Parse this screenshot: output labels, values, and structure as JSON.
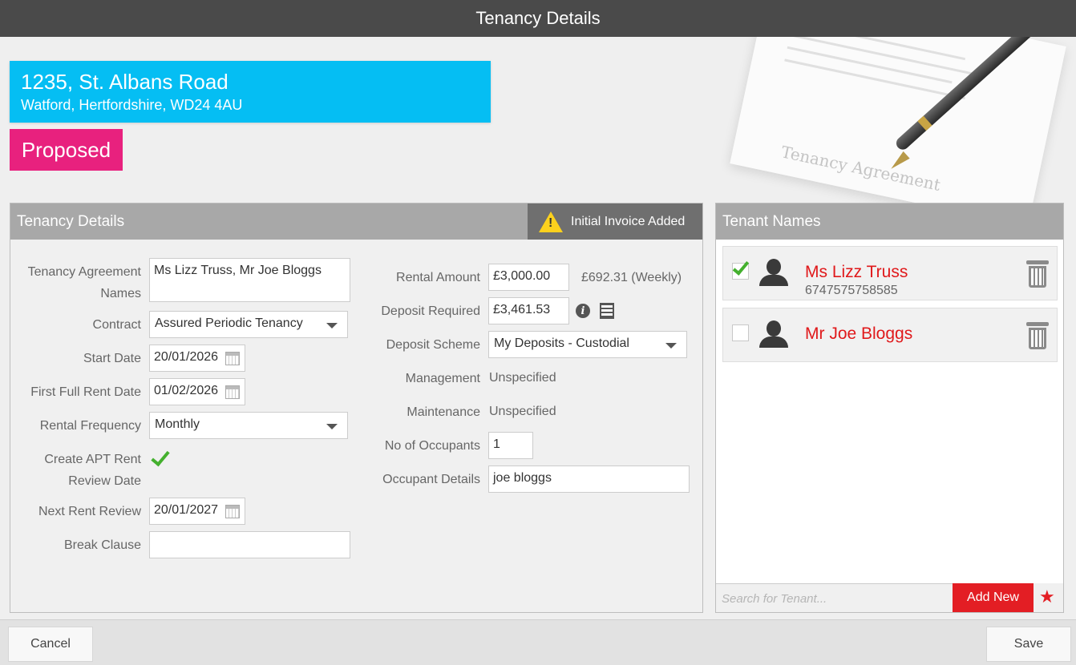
{
  "window": {
    "title": "Tenancy Details"
  },
  "hero": {
    "paper_title": "Tenancy Agreement"
  },
  "property": {
    "address_line1": "1235, St. Albans Road",
    "address_line2": "Watford, Hertfordshire, WD24 4AU",
    "status": "Proposed",
    "status_color": "#e8217e",
    "accent_color": "#05bef3"
  },
  "tenancy": {
    "panel_title": "Tenancy Details",
    "invoice_notice": "Initial Invoice Added",
    "agreement_names_label_1": "Tenancy Agreement",
    "agreement_names_label_2": "Names",
    "agreement_names_value": "Ms Lizz Truss, Mr Joe Bloggs",
    "contract_label": "Contract",
    "contract_value": "Assured Periodic Tenancy",
    "start_date_label": "Start Date",
    "start_date_value": "20/01/2026",
    "first_full_rent_label": "First Full Rent Date",
    "first_full_rent_value": "01/02/2026",
    "rental_frequency_label": "Rental Frequency",
    "rental_frequency_value": "Monthly",
    "apt_review_label_1": "Create APT Rent",
    "apt_review_label_2": "Review Date",
    "next_review_label": "Next Rent Review",
    "next_review_value": "20/01/2027",
    "break_clause_label": "Break Clause",
    "break_clause_value": "",
    "rental_amount_label": "Rental Amount",
    "rental_amount_value": "£3,000.00",
    "weekly_amount": "£692.31 (Weekly)",
    "deposit_required_label": "Deposit Required",
    "deposit_required_value": "£3,461.53",
    "deposit_scheme_label": "Deposit Scheme",
    "deposit_scheme_value": "My Deposits - Custodial",
    "management_label": "Management",
    "management_value": "Unspecified",
    "maintenance_label": "Maintenance",
    "maintenance_value": "Unspecified",
    "occupants_label": "No of Occupants",
    "occupants_value": "1",
    "occupant_details_label": "Occupant Details",
    "occupant_details_value": "joe bloggs"
  },
  "tenants": {
    "panel_title": "Tenant Names",
    "list": [
      {
        "name": "Ms Lizz Truss",
        "phone": "6747575758585",
        "checked": true
      },
      {
        "name": "Mr Joe Bloggs",
        "phone": "",
        "checked": false
      }
    ],
    "search_placeholder": "Search for Tenant...",
    "add_new_label": "Add New",
    "name_color": "#e0191b"
  },
  "footer": {
    "cancel_label": "Cancel",
    "save_label": "Save"
  }
}
